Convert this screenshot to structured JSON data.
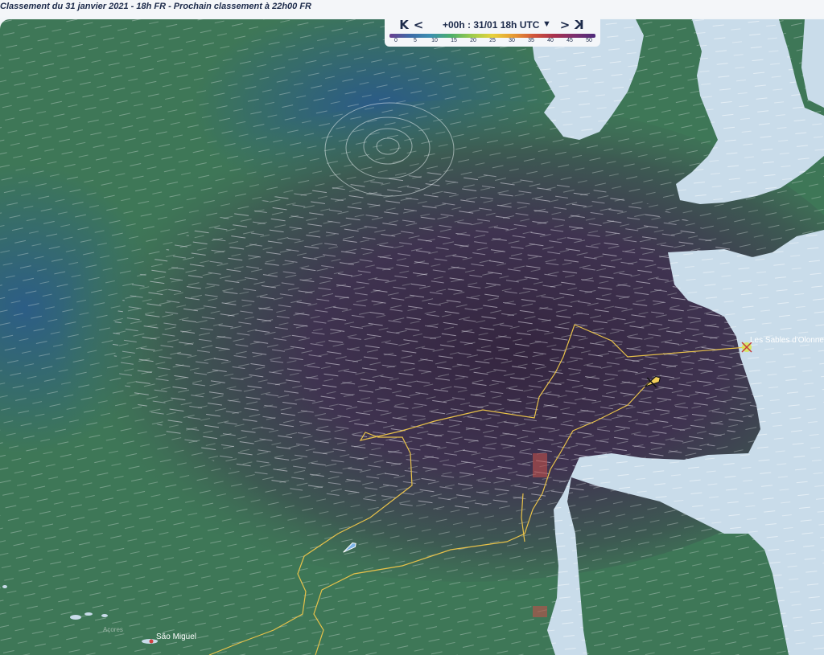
{
  "header": {
    "ranking_text": "Classement du 31 janvier 2021 - 18h FR -  Prochain classement à  22h00  FR"
  },
  "timeline": {
    "first_icon": "skip-first-icon",
    "prev_icon": "previous-icon",
    "time_label": "+00h : 31/01 18h UTC",
    "dropdown_icon": "caret-down-icon",
    "next_icon": "next-icon",
    "last_icon": "skip-last-icon",
    "first_glyph": "K",
    "prev_glyph": "<",
    "next_glyph": ">",
    "last_glyph": "K",
    "scale_ticks": [
      "0",
      "5",
      "10",
      "15",
      "20",
      "25",
      "30",
      "35",
      "40",
      "45",
      "50"
    ]
  },
  "map": {
    "places": {
      "les_sables": "Les Sables d'Olonne",
      "sao_miguel": "São Miguel",
      "acores": "Açores"
    },
    "colors": {
      "calm": "#2f5f8c",
      "moderate": "#3f7d5a",
      "strong": "#3a2845",
      "land": "#c9dcea",
      "track": "#e8c24a"
    }
  }
}
